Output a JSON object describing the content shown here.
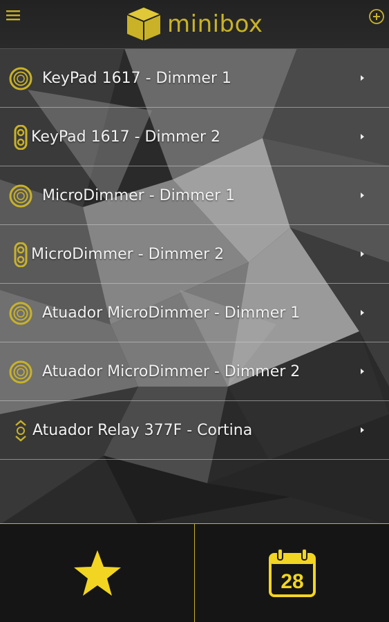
{
  "colors": {
    "accent": "#c9b227",
    "text": "#f2f2f2",
    "divider": "#d2d2d2"
  },
  "header": {
    "app_name": "minibox",
    "menu_icon": "hamburger-icon",
    "add_icon": "plus-circle-icon"
  },
  "devices": [
    {
      "label": "KeyPad 1617 - Dimmer 1",
      "icon": "dimmer-ring-icon"
    },
    {
      "label": "KeyPad 1617 - Dimmer 2",
      "icon": "switch-chain-icon"
    },
    {
      "label": "MicroDimmer - Dimmer 1",
      "icon": "dimmer-ring-icon"
    },
    {
      "label": "MicroDimmer - Dimmer 2",
      "icon": "switch-chain-icon"
    },
    {
      "label": "Atuador MicroDimmer - Dimmer 1",
      "icon": "dimmer-ring-icon"
    },
    {
      "label": "Atuador MicroDimmer - Dimmer 2",
      "icon": "dimmer-ring-icon"
    },
    {
      "label": "Atuador Relay 377F - Cortina",
      "icon": "curtain-updown-icon"
    }
  ],
  "tabbar": {
    "favorites_icon": "star-icon",
    "calendar_icon": "calendar-icon",
    "calendar_day": "28"
  }
}
